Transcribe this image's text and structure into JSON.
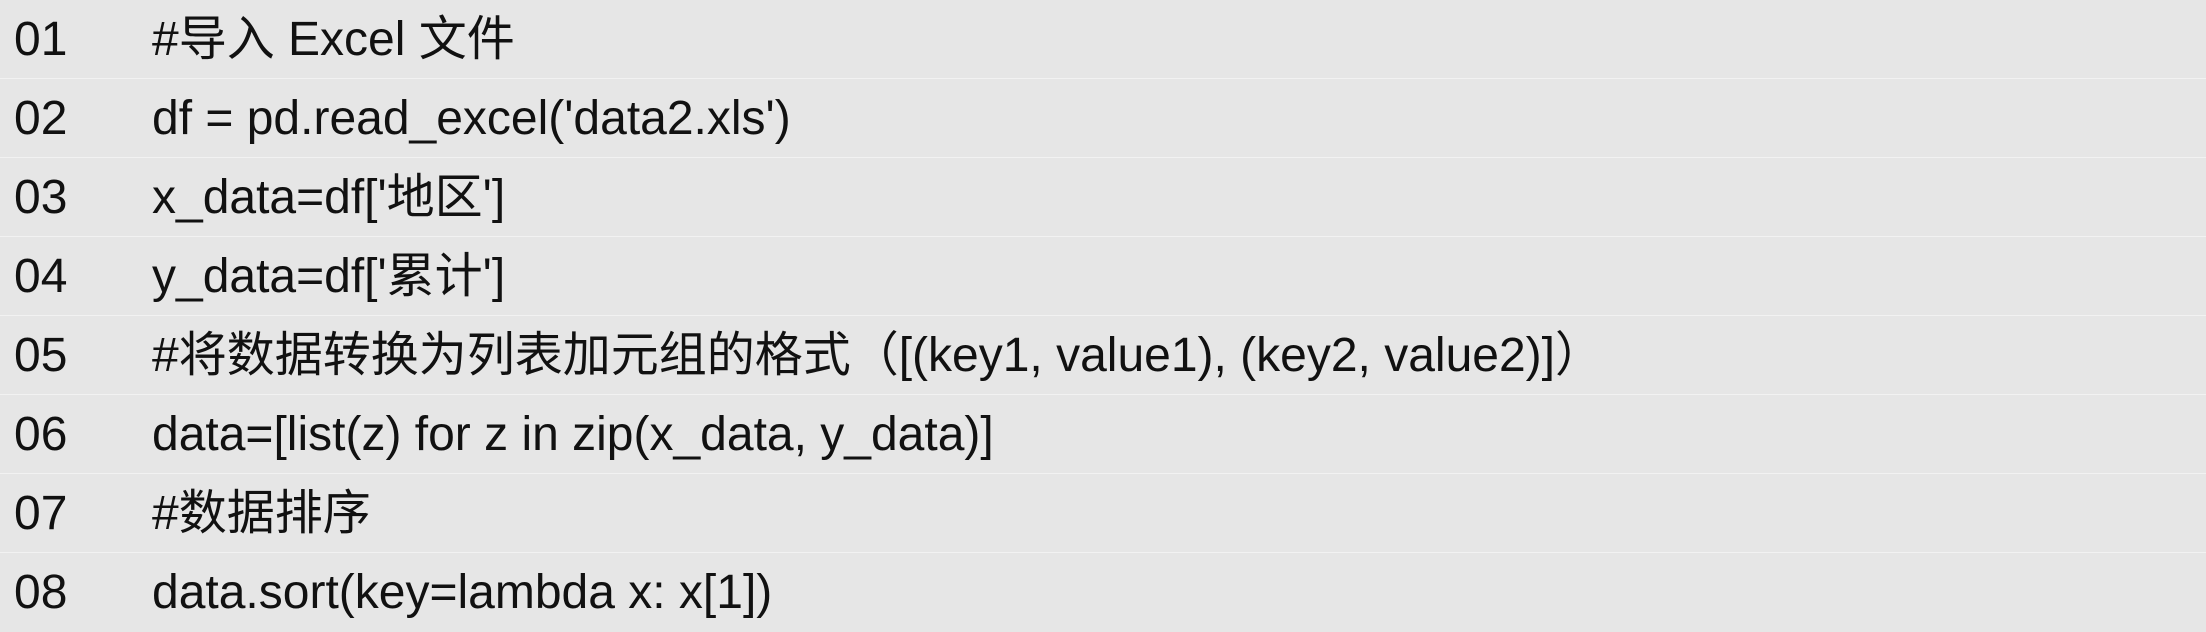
{
  "code": {
    "lines": [
      {
        "number": "01",
        "text": "#导入 Excel 文件"
      },
      {
        "number": "02",
        "text": "df = pd.read_excel('data2.xls')"
      },
      {
        "number": "03",
        "text": "x_data=df['地区']"
      },
      {
        "number": "04",
        "text": "y_data=df['累计']"
      },
      {
        "number": "05",
        "text": "#将数据转换为列表加元组的格式（[(key1, value1), (key2, value2)]）"
      },
      {
        "number": "06",
        "text": "data=[list(z) for z in zip(x_data, y_data)]"
      },
      {
        "number": "07",
        "text": "#数据排序"
      },
      {
        "number": "08",
        "text": "data.sort(key=lambda x: x[1])"
      }
    ]
  }
}
